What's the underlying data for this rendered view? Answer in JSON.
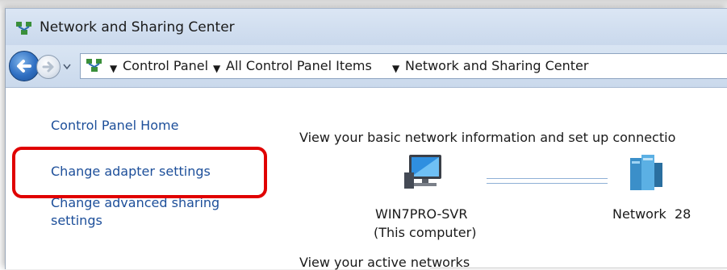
{
  "window": {
    "title": "Network and Sharing Center"
  },
  "address_bar": {
    "crumbs": [
      "Control Panel",
      "All Control Panel Items",
      "Network and Sharing Center"
    ]
  },
  "left_pane": {
    "links": [
      {
        "label": "Control Panel Home"
      },
      {
        "label": "Change adapter settings",
        "highlighted": true
      },
      {
        "label_line1": "Change advanced sharing",
        "label_line2": "settings"
      }
    ]
  },
  "main": {
    "heading": "View your basic network information and set up connectio",
    "computer": {
      "name": "WIN7PRO-SVR",
      "subtitle": "(This computer)"
    },
    "network": {
      "name": "Network  28"
    },
    "active_networks_label": "View your active networks"
  },
  "colors": {
    "link": "#1d4f9a",
    "highlight_border": "#e00000",
    "titlebar": "#c9d8ec"
  }
}
